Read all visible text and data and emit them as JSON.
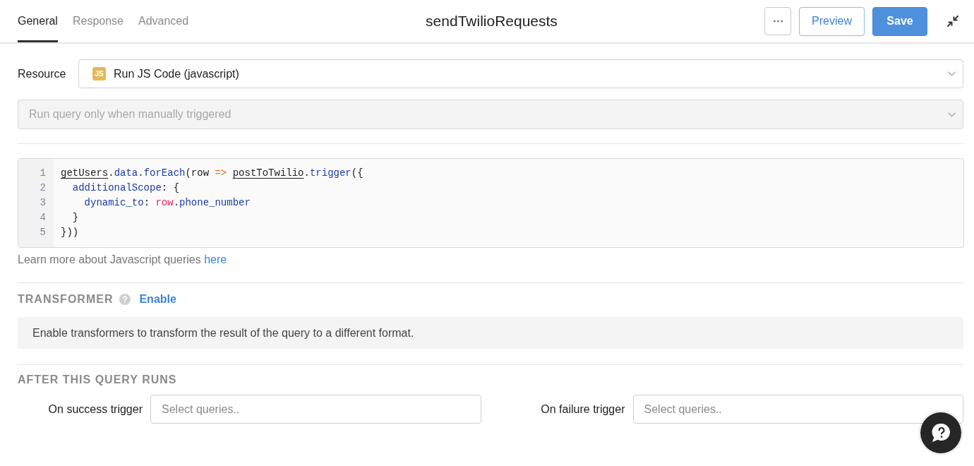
{
  "header": {
    "tabs": [
      {
        "label": "General",
        "selected": true
      },
      {
        "label": "Response",
        "selected": false
      },
      {
        "label": "Advanced",
        "selected": false
      }
    ],
    "title": "sendTwilioRequests",
    "actions": [
      {
        "kind": "more"
      },
      {
        "kind": "secondary",
        "label": "Preview"
      },
      {
        "kind": "primary",
        "label": "Save"
      }
    ]
  },
  "resource": {
    "label": "Resource",
    "badge": "JS",
    "value": "Run JS Code (javascript)"
  },
  "trigger_mode": {
    "value": "Run query only when manually triggered",
    "disabled": true
  },
  "editor": {
    "lines": [
      {
        "number": "1",
        "tokens": [
          {
            "text": "getUsers",
            "kind": "reference"
          },
          {
            "text": ".",
            "kind": "plain"
          },
          {
            "text": "data",
            "kind": "property"
          },
          {
            "text": ".",
            "kind": "plain"
          },
          {
            "text": "forEach",
            "kind": "property"
          },
          {
            "text": "(row ",
            "kind": "plain"
          },
          {
            "text": "=> ",
            "kind": "operator"
          },
          {
            "text": "postToTwilio",
            "kind": "reference"
          },
          {
            "text": ".",
            "kind": "plain"
          },
          {
            "text": "trigger",
            "kind": "property"
          },
          {
            "text": "({",
            "kind": "plain"
          }
        ]
      },
      {
        "number": "2",
        "tokens": [
          {
            "text": "  additionalScope",
            "kind": "property"
          },
          {
            "text": ": {",
            "kind": "plain"
          }
        ]
      },
      {
        "number": "3",
        "tokens": [
          {
            "text": "    dynamic_to",
            "kind": "property"
          },
          {
            "text": ": ",
            "kind": "plain"
          },
          {
            "text": "row",
            "kind": "variable"
          },
          {
            "text": ".",
            "kind": "plain"
          },
          {
            "text": "phone_number",
            "kind": "property"
          }
        ]
      },
      {
        "number": "4",
        "tokens": [
          {
            "text": "  }",
            "kind": "plain"
          }
        ]
      },
      {
        "number": "5",
        "tokens": [
          {
            "text": "}))",
            "kind": "plain"
          }
        ]
      }
    ]
  },
  "help_text": {
    "text": "Learn more about Javascript queries",
    "link": "here"
  },
  "transformer": {
    "title": "TRANSFORMER",
    "link": "Enable",
    "info": "Enable transformers to transform the result of the query to a different format."
  },
  "after_run": {
    "title": "AFTER THIS QUERY RUNS",
    "triggers": [
      {
        "label": "On success trigger",
        "placeholder": "Select queries.."
      },
      {
        "label": "On failure trigger",
        "placeholder": "Select queries.."
      }
    ]
  }
}
